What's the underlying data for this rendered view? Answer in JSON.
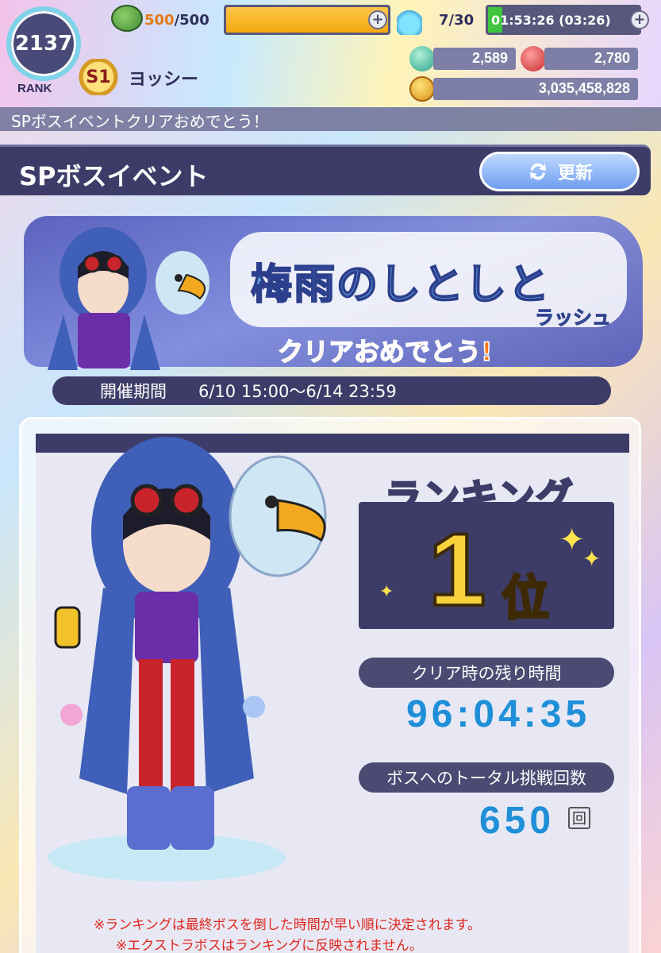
{
  "status": {
    "rank_number": "2137",
    "rank_label": "RANK",
    "stamina_current": "500",
    "stamina_max": "/500",
    "stamina_fill_fraction": 1.0,
    "potion_count": "7/30",
    "timer": "01:53:26 (03:26)",
    "badge": "S1",
    "username": "ヨッシー",
    "gems": "2,589",
    "jewels": "2,780",
    "coins": "3,035,458,828"
  },
  "ticker": "SPボスイベントクリアおめでとう！",
  "header": {
    "title": "SPボスイベント",
    "refresh_label": "更新"
  },
  "banner": {
    "title": "梅雨のしとしと",
    "subtitle": "ラッシュ",
    "clear_message": "クリアおめでとう!",
    "period_label": "開催期間",
    "period_value": "6/10 15:00～6/14 23:59"
  },
  "result": {
    "ranking_title": "ランキング",
    "rank_value": "1",
    "rank_unit": "位",
    "remaining_label": "クリア時の残り時間",
    "remaining_value": "96:04:35",
    "challenges_label": "ボスへのトータル挑戦回数",
    "challenges_value": "650",
    "challenges_unit": "回",
    "notes": [
      "※ランキングは最終ボスを倒した時間が早い順に決定されます。",
      "※エクストラボスはランキングに反映されません。"
    ]
  },
  "colors": {
    "navy": "#3d3c68",
    "accent_blue": "#1e8fd8",
    "gold": "#f7d23c",
    "note_red": "#e0261e"
  }
}
